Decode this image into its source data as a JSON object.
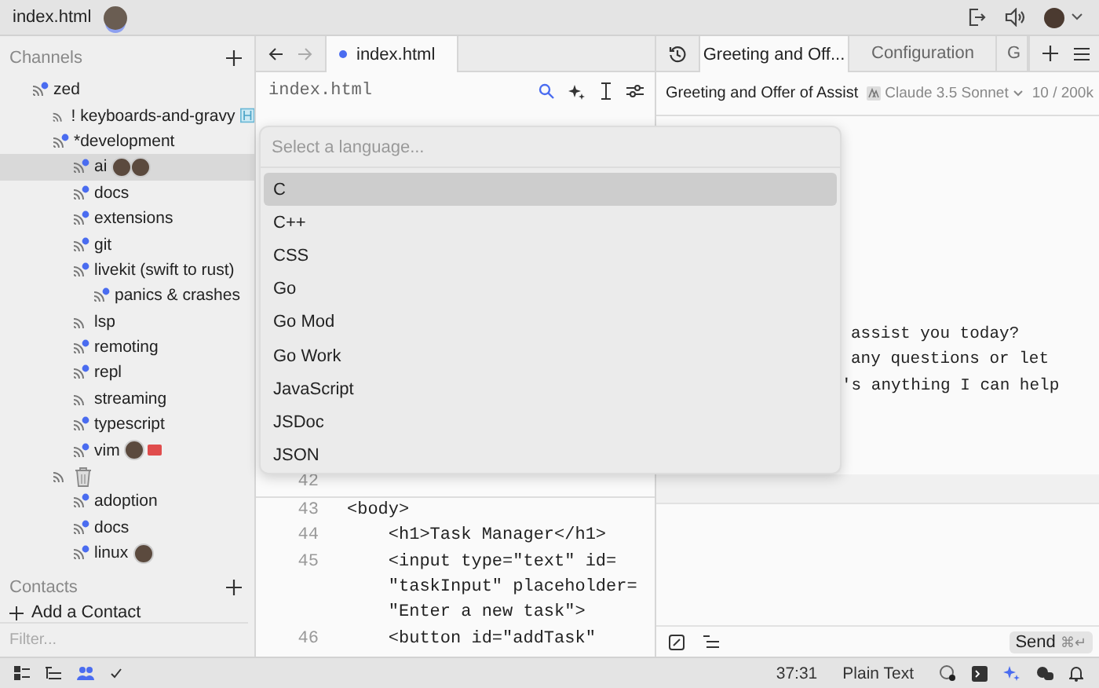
{
  "title_bar": {
    "file": "index.html"
  },
  "sidebar": {
    "channels_heading": "Channels",
    "channels": [
      {
        "kind": "channel",
        "name": "zed",
        "unread": true,
        "selected": false,
        "children": [
          {
            "kind": "channel",
            "name": "! keyboards-and-gravy",
            "unread": false,
            "selected": false,
            "participants": [
              {
                "kind": "notes"
              }
            ]
          },
          {
            "kind": "channel",
            "name": "*development",
            "unread": true,
            "selected": false,
            "children": [
              {
                "kind": "channel",
                "name": "ai",
                "unread": true,
                "selected": true,
                "participants": [
                  {
                    "kind": "avatar"
                  },
                  {
                    "kind": "avatar"
                  }
                ]
              },
              {
                "kind": "channel",
                "name": "docs",
                "unread": true,
                "selected": false
              },
              {
                "kind": "channel",
                "name": "extensions",
                "unread": true,
                "selected": false
              },
              {
                "kind": "channel",
                "name": "git",
                "unread": true,
                "selected": false
              },
              {
                "kind": "channel",
                "name": "livekit (swift to rust)",
                "unread": true,
                "selected": false,
                "children": [
                  {
                    "kind": "channel",
                    "name": "panics & crashes",
                    "unread": true,
                    "selected": false
                  }
                ]
              },
              {
                "kind": "channel",
                "name": "lsp",
                "unread": false,
                "selected": false
              },
              {
                "kind": "channel",
                "name": "remoting",
                "unread": true,
                "selected": false
              },
              {
                "kind": "channel",
                "name": "repl",
                "unread": true,
                "selected": false
              },
              {
                "kind": "channel",
                "name": "streaming",
                "unread": false,
                "selected": false
              },
              {
                "kind": "channel",
                "name": "typescript",
                "unread": true,
                "selected": false
              },
              {
                "kind": "channel",
                "name": "vim",
                "unread": true,
                "selected": false,
                "participants": [
                  {
                    "kind": "avatar"
                  },
                  {
                    "kind": "tag"
                  }
                ]
              }
            ]
          },
          {
            "kind": "trash",
            "unread": false,
            "selected": false,
            "children": [
              {
                "kind": "channel",
                "name": "adoption",
                "unread": true,
                "selected": false
              },
              {
                "kind": "channel",
                "name": "docs",
                "unread": true,
                "selected": false
              },
              {
                "kind": "channel",
                "name": "linux",
                "unread": true,
                "selected": false,
                "participants": [
                  {
                    "kind": "avatar"
                  }
                ]
              }
            ]
          }
        ]
      }
    ],
    "contacts_heading": "Contacts",
    "add_contact": "Add a Contact",
    "filter": {
      "placeholder": "Filter..."
    }
  },
  "editor": {
    "tabs": [
      {
        "label": "index.html",
        "modified": true,
        "selected": true
      }
    ],
    "breadcrumb": "index.html",
    "code": [
      {
        "number": "42"
      },
      {
        "number": "43",
        "text": "<body>"
      },
      {
        "number": "44",
        "text": "    <h1>Task Manager</h1>"
      },
      {
        "number": "45",
        "text": "    <input type=\"text\" id="
      },
      {
        "text": "    \"taskInput\" placeholder="
      },
      {
        "text": "    \"Enter a new task\">"
      },
      {
        "number": "46",
        "text": "    <button id=\"addTask\""
      }
    ]
  },
  "language_picker": {
    "placeholder": "Select a language...",
    "options": [
      {
        "label": "C",
        "selected": true
      },
      {
        "label": "C++",
        "selected": false
      },
      {
        "label": "CSS",
        "selected": false
      },
      {
        "label": "Go",
        "selected": false
      },
      {
        "label": "Go Mod",
        "selected": false
      },
      {
        "label": "Go Work",
        "selected": false
      },
      {
        "label": "JavaScript",
        "selected": false
      },
      {
        "label": "JSDoc",
        "selected": false
      },
      {
        "label": "JSON",
        "selected": false
      }
    ]
  },
  "assistant": {
    "tabs": [
      {
        "label": "Greeting and Off...",
        "selected": true
      },
      {
        "label": "Configuration",
        "selected": false
      },
      {
        "label": "G",
        "selected": false
      }
    ],
    "title": "Greeting and Offer of Assist",
    "model": "Claude 3.5 Sonnet",
    "tokens": "10 / 200k",
    "message_lines": [
      "assist you today?",
      "any questions or let",
      "'s anything I can help"
    ],
    "send": "Send",
    "send_shortcut": "⌘↵"
  },
  "status_bar": {
    "cursor": "37:31",
    "language": "Plain Text"
  }
}
